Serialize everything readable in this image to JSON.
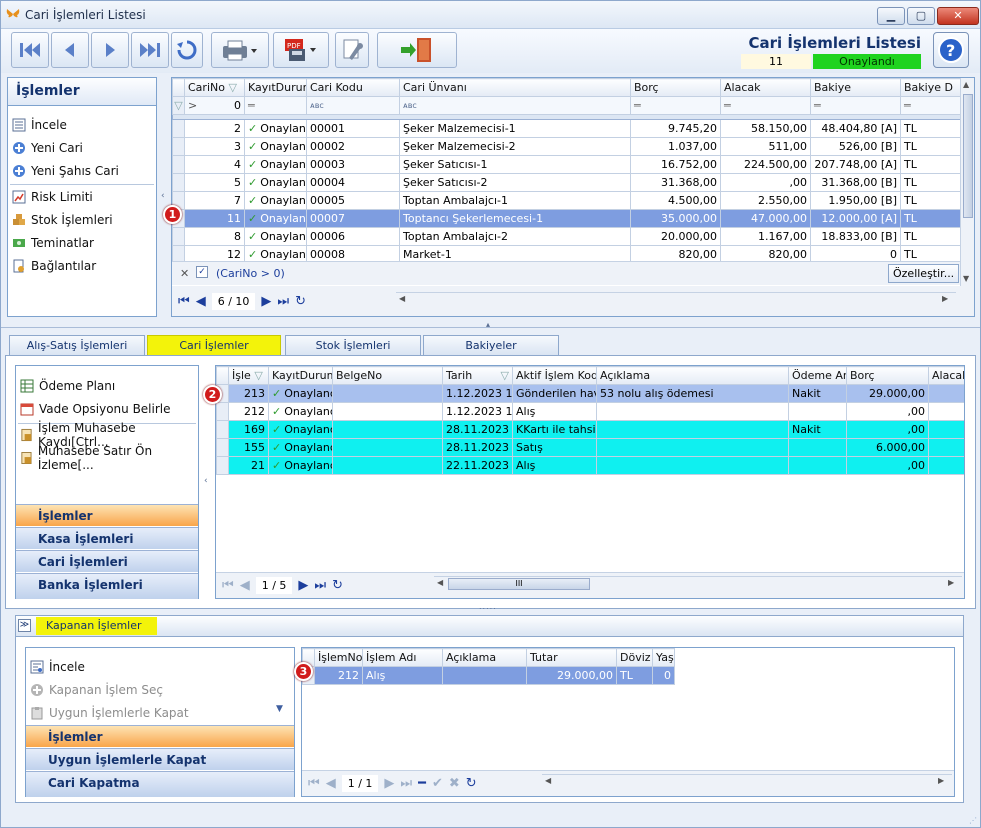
{
  "window": {
    "title": "Cari İşlemleri Listesi"
  },
  "header": {
    "title": "Cari İşlemleri Listesi",
    "count": "11",
    "status": "Onaylandı"
  },
  "nav": {
    "title": "İşlemler",
    "items": [
      {
        "label": "İncele",
        "icon": "list-icon"
      },
      {
        "label": "Yeni Cari",
        "icon": "plus-circle-icon"
      },
      {
        "label": "Yeni Şahıs Cari",
        "icon": "plus-circle-icon"
      },
      {
        "label": "Risk Limiti",
        "icon": "chart-icon"
      },
      {
        "label": "Stok İşlemleri",
        "icon": "boxes-icon"
      },
      {
        "label": "Teminatlar",
        "icon": "money-icon"
      },
      {
        "label": "Bağlantılar",
        "icon": "link-icon"
      }
    ]
  },
  "grid1": {
    "columns": [
      "CariNo",
      "KayıtDurumu",
      "Cari Kodu",
      "Cari Ünvanı",
      "Borç",
      "Alacak",
      "Bakiye",
      "Bakiye D"
    ],
    "filter_cari_no": "0",
    "rows": [
      [
        "2",
        "Onaylan",
        "00001",
        "Şeker Malzemecisi-1",
        "9.745,20",
        "58.150,00",
        "48.404,80 [A]",
        "TL"
      ],
      [
        "3",
        "Onaylan",
        "00002",
        "Şeker Malzemecisi-2",
        "1.037,00",
        "511,00",
        "526,00 [B]",
        "TL"
      ],
      [
        "4",
        "Onaylan",
        "00003",
        "Şeker Satıcısı-1",
        "16.752,00",
        "224.500,00",
        "207.748,00 [A]",
        "TL"
      ],
      [
        "5",
        "Onaylan",
        "00004",
        "Şeker Satıcısı-2",
        "31.368,00",
        ",00",
        "31.368,00 [B]",
        "TL"
      ],
      [
        "7",
        "Onaylan",
        "00005",
        "Toptan Ambalajcı-1",
        "4.500,00",
        "2.550,00",
        "1.950,00 [B]",
        "TL"
      ],
      [
        "11",
        "Onaylan",
        "00007",
        "Toptancı Şekerlemecesi-1",
        "35.000,00",
        "47.000,00",
        "12.000,00 [A]",
        "TL"
      ],
      [
        "8",
        "Onaylan",
        "00006",
        "Toptan Ambalajcı-2",
        "20.000,00",
        "1.167,00",
        "18.833,00 [B]",
        "TL"
      ],
      [
        "12",
        "Onaylan",
        "00008",
        "Market-1",
        "820,00",
        "820,00",
        "0",
        "TL"
      ]
    ],
    "selected_index": 5,
    "filter_text": "(CariNo > 0)",
    "customize_label": "Özelleştir...",
    "pager": "6 / 10"
  },
  "tabs": [
    "Alış-Satış İşlemleri",
    "Cari İşlemler",
    "Stok İşlemleri",
    "Bakiyeler"
  ],
  "active_tab": 1,
  "mid_nav": {
    "items": [
      {
        "label": "Ödeme Planı",
        "icon": "table-icon"
      },
      {
        "label": "Vade Opsiyonu Belirle",
        "icon": "calendar-icon"
      },
      {
        "label": "İşlem Muhasebe Kaydı[Ctrl...",
        "icon": "ledger-icon"
      },
      {
        "label": "Muhasebe Satır Ön İzleme[...",
        "icon": "ledger-icon"
      }
    ],
    "groups": [
      "İşlemler",
      "Kasa İşlemleri",
      "Cari İşlemleri",
      "Banka İşlemleri"
    ]
  },
  "grid2": {
    "columns": [
      "İşle",
      "KayıtDurumu",
      "BelgeNo",
      "Tarih",
      "Aktif İşlem Kodu",
      "Açıklama",
      "Ödeme Araç",
      "Borç",
      "Alacak"
    ],
    "rows": [
      [
        "213",
        "Onaylanc",
        "",
        "1.12.2023 10",
        "Gönderilen haval",
        "53 nolu alış ödemesi",
        "Nakit",
        "29.000,00",
        ""
      ],
      [
        "212",
        "Onaylanc",
        "",
        "1.12.2023 10",
        "Alış",
        "",
        "",
        ",00",
        "2"
      ],
      [
        "169",
        "Onaylanc",
        "",
        "28.11.2023 1",
        "KKartı ile tahsilat",
        "",
        "Nakit",
        ",00",
        ""
      ],
      [
        "155",
        "Onaylanc",
        "",
        "28.11.2023 1",
        "Satış",
        "",
        "",
        "6.000,00",
        ""
      ],
      [
        "21",
        "Onaylanc",
        "",
        "22.11.2023 0",
        "Alış",
        "",
        "",
        ",00",
        "1"
      ]
    ],
    "pager": "1 / 5",
    "scroll_label": "III"
  },
  "closed": {
    "title": "Kapanan İşlemler",
    "nav": [
      {
        "label": "İncele",
        "icon": "list-icon",
        "enabled": true
      },
      {
        "label": "Kapanan İşlem Seç",
        "icon": "plus-circle-icon",
        "enabled": false
      },
      {
        "label": "Uygun İşlemlerle Kapat",
        "icon": "clipboard-icon",
        "enabled": false
      }
    ],
    "groups": [
      "İşlemler",
      "Uygun İşlemlerle Kapat",
      "Cari Kapatma"
    ],
    "grid": {
      "columns": [
        "İşlemNo",
        "İşlem Adı",
        "Açıklama",
        "Tutar",
        "Döviz",
        "Yaş"
      ],
      "rows": [
        [
          "212",
          "Alış",
          "",
          "29.000,00",
          "TL",
          "0"
        ]
      ]
    },
    "pager": "1 / 1"
  },
  "badges": [
    "1",
    "2",
    "3"
  ],
  "colors": {
    "accent": "#14336e",
    "selected_row": "#7e9de0",
    "cyan_row": "#00f0f0",
    "status_green": "#1fd31f",
    "active_tab": "#f3f30a",
    "active_group": "#f9a54a",
    "badge": "#d11b1b"
  }
}
